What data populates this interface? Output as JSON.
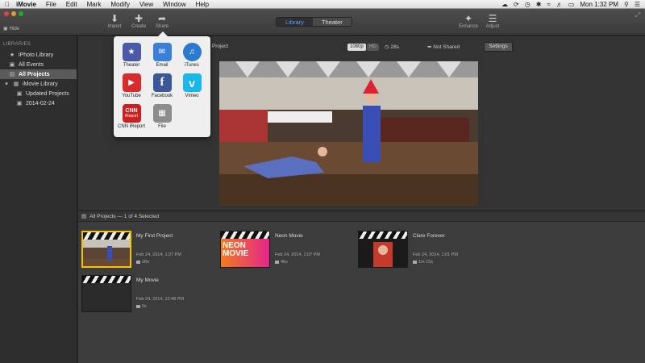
{
  "menubar": {
    "app_name": "iMovie",
    "menus": [
      "File",
      "Edit",
      "Mark",
      "Modify",
      "View",
      "Window",
      "Help"
    ],
    "clock": "Mon 1:32 PM"
  },
  "toolbar": {
    "hide_label": "Hide",
    "import_label": "Import",
    "create_label": "Create",
    "share_label": "Share",
    "library_tab": "Library",
    "theater_tab": "Theater",
    "enhance_label": "Enhance",
    "adjust_label": "Adjust"
  },
  "sidebar": {
    "section_header": "LIBRARIES",
    "items": [
      {
        "label": "iPhoto Library",
        "icon": "star-icon"
      },
      {
        "label": "All Events",
        "icon": "film-icon"
      },
      {
        "label": "All Projects",
        "icon": "folder-icon"
      },
      {
        "label": "iMovie Library",
        "icon": "grid-icon"
      },
      {
        "label": "Updated Projects",
        "icon": "film-icon"
      },
      {
        "label": "2014-02-24",
        "icon": "film-icon"
      }
    ]
  },
  "viewer": {
    "project_title": "st Project",
    "resolution": "1080p",
    "hd_label": "HD",
    "duration": "28s",
    "share_status": "Not Shared",
    "settings_label": "Settings"
  },
  "share_menu": {
    "options": [
      {
        "label": "Theater",
        "color": "#4a5aa8"
      },
      {
        "label": "Email",
        "color": "#3b7fd6"
      },
      {
        "label": "iTunes",
        "color": "#2a7bd0"
      },
      {
        "label": "YouTube",
        "color": "#d92b2b"
      },
      {
        "label": "Facebook",
        "color": "#3b5998"
      },
      {
        "label": "Vimeo",
        "color": "#1ab7ea"
      },
      {
        "label": "CNN iReport",
        "color": "#cc1f1f"
      },
      {
        "label": "File",
        "color": "#8c8c8c"
      }
    ],
    "cnn_text": "CNN",
    "ireport_text": "iReport"
  },
  "projects_panel": {
    "header": "All Projects — 1 of 4 Selected",
    "projects": [
      {
        "name": "My First Project",
        "date": "Feb 24, 2014, 1:27 PM",
        "duration": "28s"
      },
      {
        "name": "Neon Movie",
        "date": "Feb 24, 2014, 1:07 PM",
        "duration": "46s"
      },
      {
        "name": "Clare Forever",
        "date": "Feb 24, 2014, 1:01 PM",
        "duration": "1m 15s"
      },
      {
        "name": "My Movie",
        "date": "Feb 24, 2014, 12:48 PM",
        "duration": "0s"
      }
    ],
    "neon_thumb_text": "NEON MOVIE"
  }
}
